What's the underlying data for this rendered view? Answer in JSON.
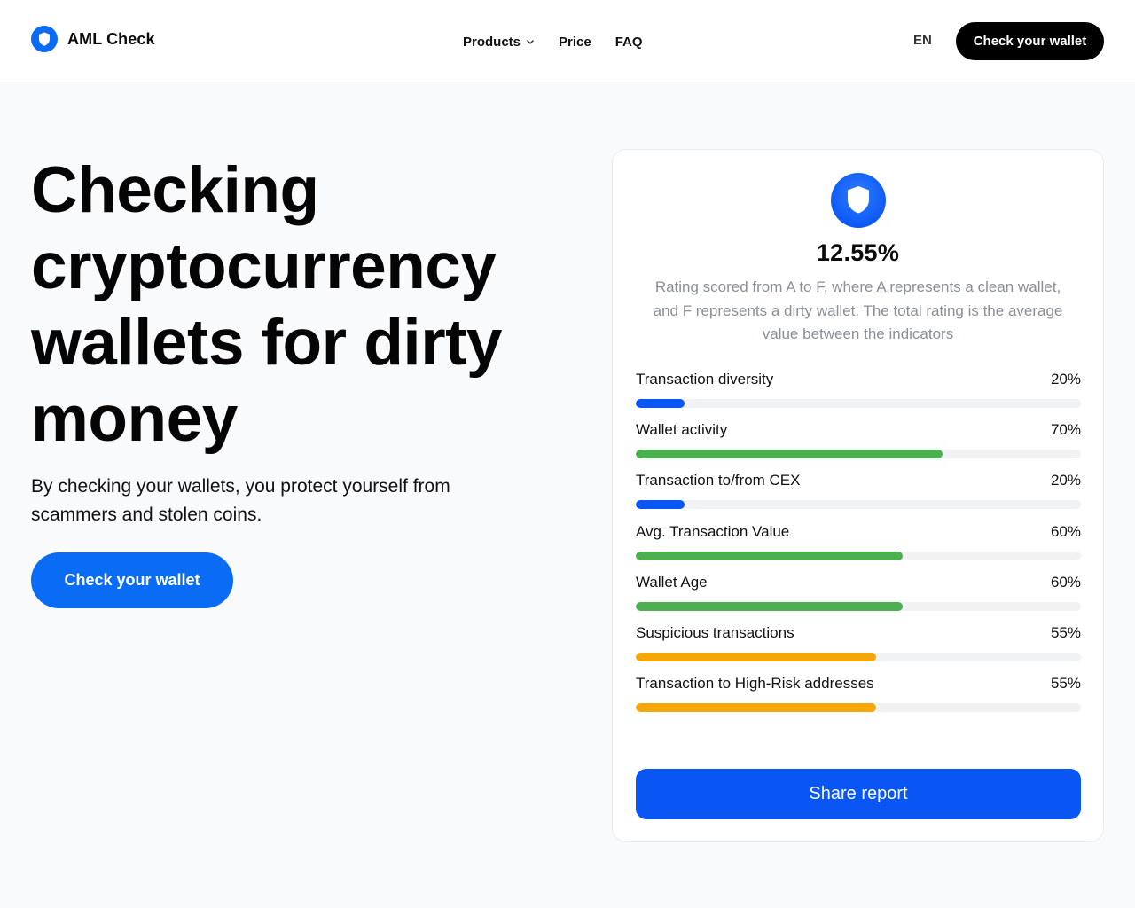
{
  "header": {
    "logo_text": "AML Check",
    "nav": [
      {
        "label": "Products",
        "has_dropdown": true
      },
      {
        "label": "Price"
      },
      {
        "label": "FAQ"
      }
    ],
    "language": "EN",
    "cta_label": "Check your wallet"
  },
  "hero": {
    "title": "Checking cryptocurrency wallets for dirty money",
    "subtitle": "By checking your wallets, you protect yourself from scammers and stolen coins.",
    "cta_label": "Check your wallet"
  },
  "card": {
    "score": "12.55%",
    "description": "Rating scored from A to F, where A represents a clean wallet, and F represents a dirty wallet. The total rating is the average value between the indicators",
    "metrics": [
      {
        "label": "Transaction diversity",
        "value": "20%",
        "percent": 11,
        "color": "#0a56f5"
      },
      {
        "label": "Wallet activity",
        "value": "70%",
        "percent": 69,
        "color": "#4caf50"
      },
      {
        "label": "Transaction to/from CEX",
        "value": "20%",
        "percent": 11,
        "color": "#0a56f5"
      },
      {
        "label": "Avg. Transaction Value",
        "value": "60%",
        "percent": 60,
        "color": "#4caf50"
      },
      {
        "label": "Wallet Age",
        "value": "60%",
        "percent": 60,
        "color": "#4caf50"
      },
      {
        "label": "Suspicious transactions",
        "value": "55%",
        "percent": 54,
        "color": "#f5a70a"
      },
      {
        "label": "Transaction to High-Risk addresses",
        "value": "55%",
        "percent": 54,
        "color": "#f5a70a"
      }
    ],
    "share_label": "Share report"
  },
  "colors": {
    "brand_blue": "#0a6cf5",
    "share_blue": "#0a56f5",
    "green": "#4caf50",
    "orange": "#f5a70a",
    "black": "#000000"
  },
  "icons": {
    "logo": "shield-icon",
    "card": "shield-icon",
    "dropdown": "chevron-down-icon"
  }
}
